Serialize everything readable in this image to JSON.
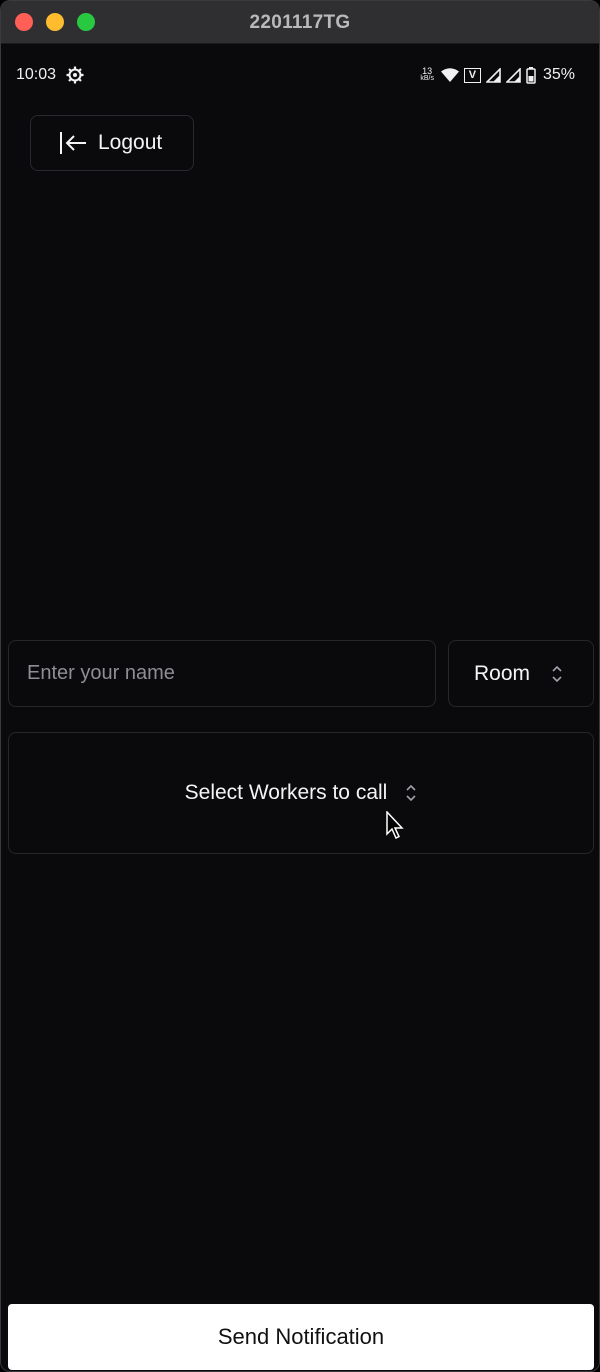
{
  "window": {
    "title": "2201117TG",
    "controls": {
      "close_color": "#ff5f57",
      "minimize_color": "#febc2e",
      "zoom_color": "#28c840"
    }
  },
  "status_bar": {
    "time": "10:03",
    "net_speed_value": "13",
    "net_speed_unit": "kB/s",
    "vpn_label": "V",
    "battery": "35%",
    "icons": [
      "settings-gear-icon",
      "wifi-icon",
      "vpn-icon",
      "signal-icon",
      "signal-icon",
      "battery-icon"
    ]
  },
  "logout": {
    "label": "Logout",
    "icon": "logout-arrow-icon"
  },
  "form": {
    "name_placeholder": "Enter your name",
    "name_value": "",
    "room_label": "Room",
    "workers_label": "Select Workers to call"
  },
  "send_button": {
    "label": "Send Notification"
  },
  "colors": {
    "background": "#0a090c",
    "border": "#27272a",
    "text": "#f4f4f5",
    "placeholder": "#8e8e93",
    "send_button_bg": "#ffffff"
  }
}
